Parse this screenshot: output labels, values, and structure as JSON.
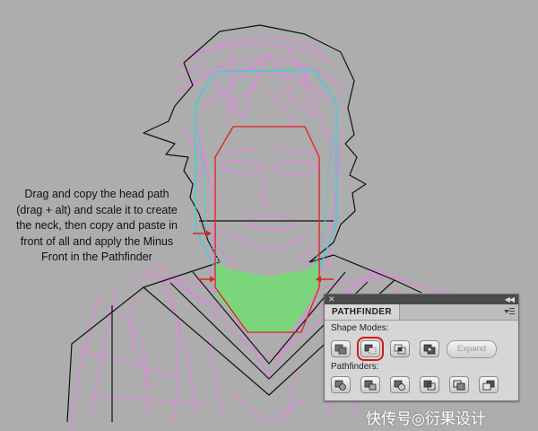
{
  "instruction": {
    "lines": [
      "Drag and copy the head path",
      "(drag + alt) and scale it to create",
      "the neck, then copy and paste in",
      "front of all and apply the Minus",
      "Front in the Pathfinder"
    ]
  },
  "panel": {
    "title": "PATHFINDER",
    "shape_modes_label": "Shape Modes:",
    "pathfinders_label": "Pathfinders:",
    "expand_label": "Expand",
    "shape_modes": [
      "unite",
      "minus-front",
      "intersect",
      "exclude"
    ],
    "selected_shape_mode": "minus-front",
    "pathfinders": [
      "divide",
      "trim",
      "merge",
      "crop",
      "outline",
      "minus-back"
    ]
  },
  "watermark": "快传号◎衍果设计",
  "colors": {
    "background": "#adadad",
    "sketch": "#d98ad6",
    "guide": "#2fd6e0",
    "highlight_path": "#e02020",
    "neck_fill": "#7bd67b"
  }
}
